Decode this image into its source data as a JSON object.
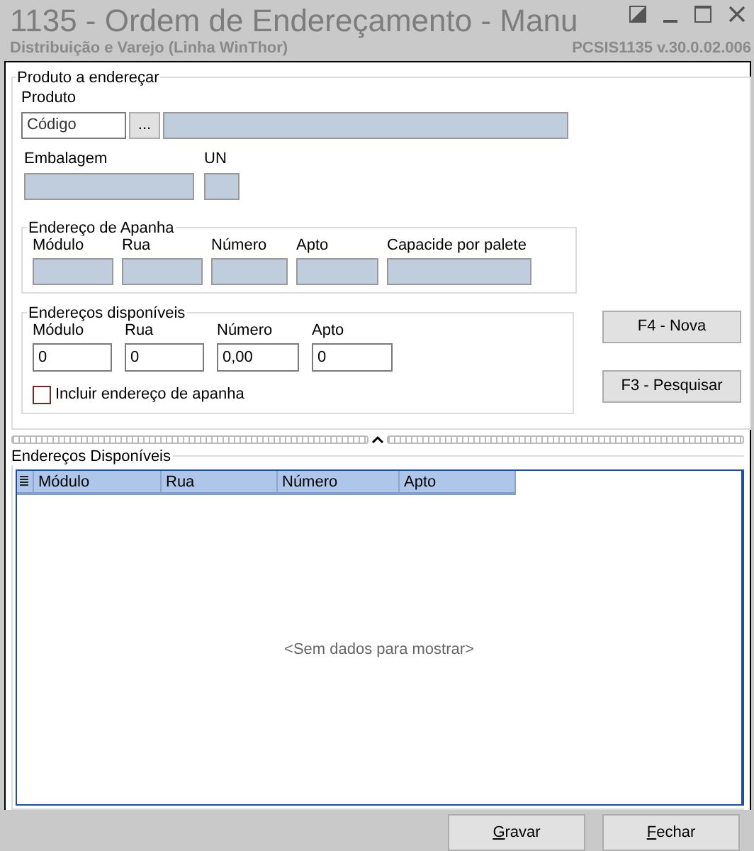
{
  "window": {
    "title": "1135 - Ordem de Endereçamento - Manu",
    "subtitle": "Distribuição e Varejo (Linha WinThor)",
    "version": "PCSIS1135  v.30.0.02.006"
  },
  "product_group": {
    "title": "Produto a endereçar",
    "product_label": "Produto",
    "code_placeholder": "Código",
    "browse_button": "...",
    "packaging_label": "Embalagem",
    "unit_label": "UN",
    "pick_group": {
      "title": "Endereço de Apanha",
      "fields": [
        {
          "label": "Módulo"
        },
        {
          "label": "Rua"
        },
        {
          "label": "Número"
        },
        {
          "label": "Apto"
        },
        {
          "label": "Capacide por palete"
        }
      ]
    },
    "available_group": {
      "title": "Endereços disponíveis",
      "fields": [
        {
          "label": "Módulo",
          "value": "0"
        },
        {
          "label": "Rua",
          "value": "0"
        },
        {
          "label": "Número",
          "value": "0,00"
        },
        {
          "label": "Apto",
          "value": "0"
        }
      ],
      "checkbox": {
        "label": "Incluir  endereço de apanha",
        "checked": false
      }
    },
    "buttons": [
      "F4 - Nova",
      "F3 - Pesquisar"
    ]
  },
  "grid_group": {
    "title": "Endereços Disponíveis",
    "columns": [
      "Módulo",
      "Rua",
      "Número",
      "Apto"
    ],
    "empty_text": "<Sem dados para mostrar>"
  },
  "footer_buttons": [
    "Gravar",
    "Fechar"
  ]
}
